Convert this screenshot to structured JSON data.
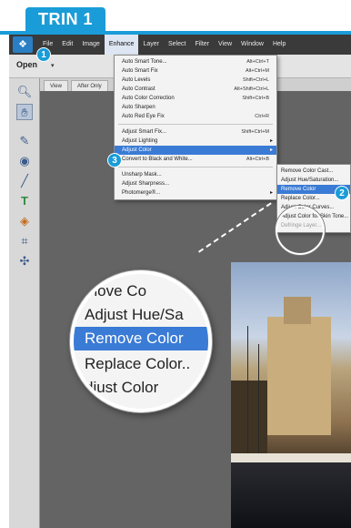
{
  "step": {
    "label": "TRIN 1",
    "color": "#1a9cd8"
  },
  "menubar": {
    "items": [
      "File",
      "Edit",
      "Image",
      "Enhance",
      "Layer",
      "Select",
      "Filter",
      "View",
      "Window",
      "Help"
    ],
    "active_index": 3
  },
  "options_bar": {
    "open_label": "Open"
  },
  "tabs": [
    "View",
    "After Only"
  ],
  "enhance_menu": {
    "items": [
      {
        "label": "Auto Smart Tone...",
        "shortcut": "Alt+Ctrl+T"
      },
      {
        "label": "Auto Smart Fix",
        "shortcut": "Alt+Ctrl+M"
      },
      {
        "label": "Auto Levels",
        "shortcut": "Shift+Ctrl+L"
      },
      {
        "label": "Auto Contrast",
        "shortcut": "Alt+Shift+Ctrl+L"
      },
      {
        "label": "Auto Color Correction",
        "shortcut": "Shift+Ctrl+B"
      },
      {
        "label": "Auto Sharpen",
        "shortcut": ""
      },
      {
        "label": "Auto Red Eye Fix",
        "shortcut": "Ctrl+R"
      },
      {
        "label": "Adjust Smart Fix...",
        "shortcut": "Shift+Ctrl+M"
      },
      {
        "label": "Adjust Lighting",
        "shortcut": ""
      },
      {
        "label": "Adjust Color",
        "shortcut": ""
      },
      {
        "label": "Convert to Black and White...",
        "shortcut": "Alt+Ctrl+B"
      },
      {
        "label": "Unsharp Mask...",
        "shortcut": ""
      },
      {
        "label": "Adjust Sharpness...",
        "shortcut": ""
      },
      {
        "label": "Photomerge®...",
        "shortcut": ""
      }
    ]
  },
  "adjust_color_submenu": {
    "items": [
      "Remove Color Cast...",
      "Adjust Hue/Saturation...",
      "Remove Color",
      "Replace Color...",
      "Adjust Color Curves...",
      "Adjust Color for Skin Tone...",
      "Defringe Layer..."
    ]
  },
  "magnifier": {
    "items": [
      "move Co",
      "Adjust Hue/Sa",
      "Remove Color",
      "Replace Color..",
      "djust Color"
    ]
  },
  "badges": {
    "b1": "1",
    "b2": "2",
    "b3": "3"
  },
  "colors": {
    "accent": "#1a9cd8",
    "highlight": "#3a7bd5",
    "menubar": "#3a3a3a",
    "canvas": "#646464"
  },
  "tool_icons": [
    "zoom-icon",
    "hand-icon",
    "quick-selection-icon",
    "red-eye-icon",
    "brush-icon",
    "text-icon",
    "paint-bucket-icon",
    "crop-icon",
    "move-icon"
  ]
}
